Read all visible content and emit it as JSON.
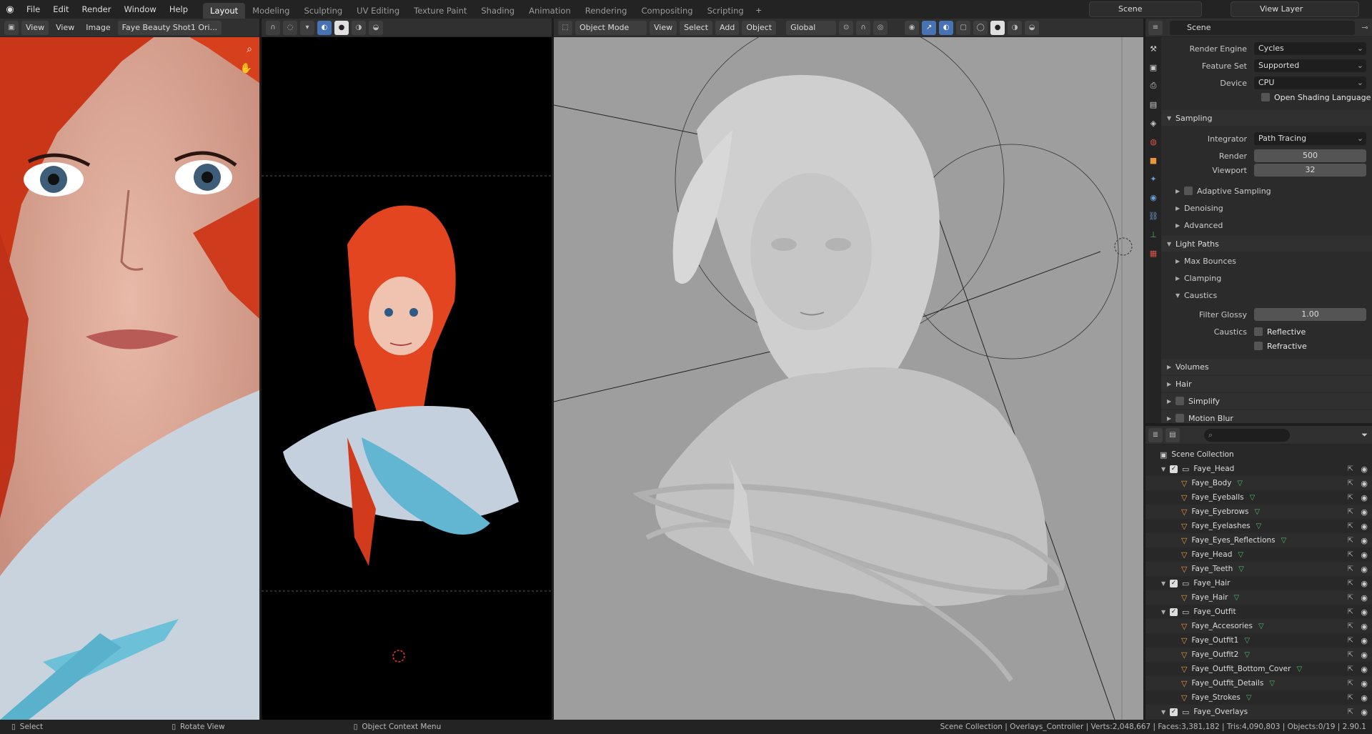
{
  "menu": {
    "file": "File",
    "edit": "Edit",
    "render": "Render",
    "window": "Window",
    "help": "Help"
  },
  "workspaces": [
    "Layout",
    "Modeling",
    "Sculpting",
    "UV Editing",
    "Texture Paint",
    "Shading",
    "Animation",
    "Rendering",
    "Compositing",
    "Scripting"
  ],
  "scene": "Scene",
  "view_layer": "View Layer",
  "image_editor": {
    "view": "View",
    "view2": "View",
    "image": "Image",
    "image_name": "Faye Beauty Shot1 Ori..."
  },
  "viewport": {
    "mode": "Object Mode",
    "view": "View",
    "select": "Select",
    "add": "Add",
    "object": "Object",
    "orientation": "Global"
  },
  "properties": {
    "render_engine_label": "Render Engine",
    "render_engine": "Cycles",
    "feature_set_label": "Feature Set",
    "feature_set": "Supported",
    "device_label": "Device",
    "device": "CPU",
    "osl": "Open Shading Language",
    "sampling": "Sampling",
    "integrator_label": "Integrator",
    "integrator": "Path Tracing",
    "render_label": "Render",
    "render_samples": "500",
    "viewport_label": "Viewport",
    "viewport_samples": "32",
    "adaptive": "Adaptive Sampling",
    "denoising": "Denoising",
    "advanced": "Advanced",
    "light_paths": "Light Paths",
    "max_bounces": "Max Bounces",
    "clamping": "Clamping",
    "caustics": "Caustics",
    "filter_glossy_label": "Filter Glossy",
    "filter_glossy": "1.00",
    "caustics_label": "Caustics",
    "reflective": "Reflective",
    "refractive": "Refractive",
    "volumes": "Volumes",
    "hair": "Hair",
    "simplify": "Simplify",
    "motion_blur": "Motion Blur"
  },
  "outliner": {
    "root": "Scene Collection",
    "rows": [
      {
        "label": "Faye_Head",
        "kind": "coll",
        "depth": 1
      },
      {
        "label": "Faye_Body",
        "kind": "mesh",
        "depth": 2
      },
      {
        "label": "Faye_Eyeballs",
        "kind": "mesh",
        "depth": 2
      },
      {
        "label": "Faye_Eyebrows",
        "kind": "mesh",
        "depth": 2
      },
      {
        "label": "Faye_Eyelashes",
        "kind": "mesh",
        "depth": 2
      },
      {
        "label": "Faye_Eyes_Reflections",
        "kind": "mesh",
        "depth": 2
      },
      {
        "label": "Faye_Head",
        "kind": "mesh",
        "depth": 2
      },
      {
        "label": "Faye_Teeth",
        "kind": "mesh",
        "depth": 2
      },
      {
        "label": "Faye_Hair",
        "kind": "coll",
        "depth": 1
      },
      {
        "label": "Faye_Hair",
        "kind": "mesh",
        "depth": 2
      },
      {
        "label": "Faye_Outfit",
        "kind": "coll",
        "depth": 1
      },
      {
        "label": "Faye_Accesories",
        "kind": "mesh",
        "depth": 2
      },
      {
        "label": "Faye_Outfit1",
        "kind": "mesh",
        "depth": 2
      },
      {
        "label": "Faye_Outfit2",
        "kind": "mesh",
        "depth": 2
      },
      {
        "label": "Faye_Outfit_Bottom_Cover",
        "kind": "mesh",
        "depth": 2
      },
      {
        "label": "Faye_Outfit_Details",
        "kind": "mesh",
        "depth": 2
      },
      {
        "label": "Faye_Strokes",
        "kind": "mesh",
        "depth": 2
      },
      {
        "label": "Faye_Overlays",
        "kind": "coll",
        "depth": 1
      }
    ]
  },
  "status": {
    "select": "Select",
    "rotate": "Rotate View",
    "context": "Object Context Menu",
    "stats": "Scene Collection | Overlays_Controller | Verts:2,048,667 | Faces:3,381,182 | Tris:4,090,803 | Objects:0/19 | 2.90.1"
  }
}
